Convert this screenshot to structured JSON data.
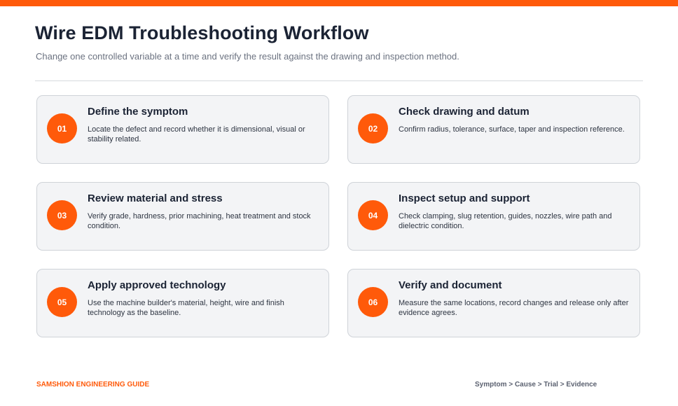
{
  "header": {
    "title": "Wire EDM Troubleshooting Workflow",
    "subtitle": "Change one controlled variable at a time and verify the result against the drawing and inspection method."
  },
  "steps": [
    {
      "number": "01",
      "title": "Define the symptom",
      "description": "Locate the defect and record whether it is dimensional, visual or stability related."
    },
    {
      "number": "02",
      "title": "Check drawing and datum",
      "description": "Confirm radius, tolerance, surface, taper and inspection reference."
    },
    {
      "number": "03",
      "title": "Review material and stress",
      "description": "Verify grade, hardness, prior machining, heat treatment and stock condition."
    },
    {
      "number": "04",
      "title": "Inspect setup and support",
      "description": "Check clamping, slug retention, guides, nozzles, wire path and dielectric condition."
    },
    {
      "number": "05",
      "title": "Apply approved technology",
      "description": "Use the machine builder's material, height, wire and finish technology as the baseline."
    },
    {
      "number": "06",
      "title": "Verify and document",
      "description": "Measure the same locations, record changes and release only after evidence agrees."
    }
  ],
  "footer": {
    "brand": "SAMSHION ENGINEERING GUIDE",
    "flow": "Symptom > Cause > Trial > Evidence"
  },
  "colors": {
    "accent": "#ff5a0a",
    "title_text": "#1b2334",
    "card_background": "#f3f4f6",
    "card_border": "#cfd3d8"
  }
}
